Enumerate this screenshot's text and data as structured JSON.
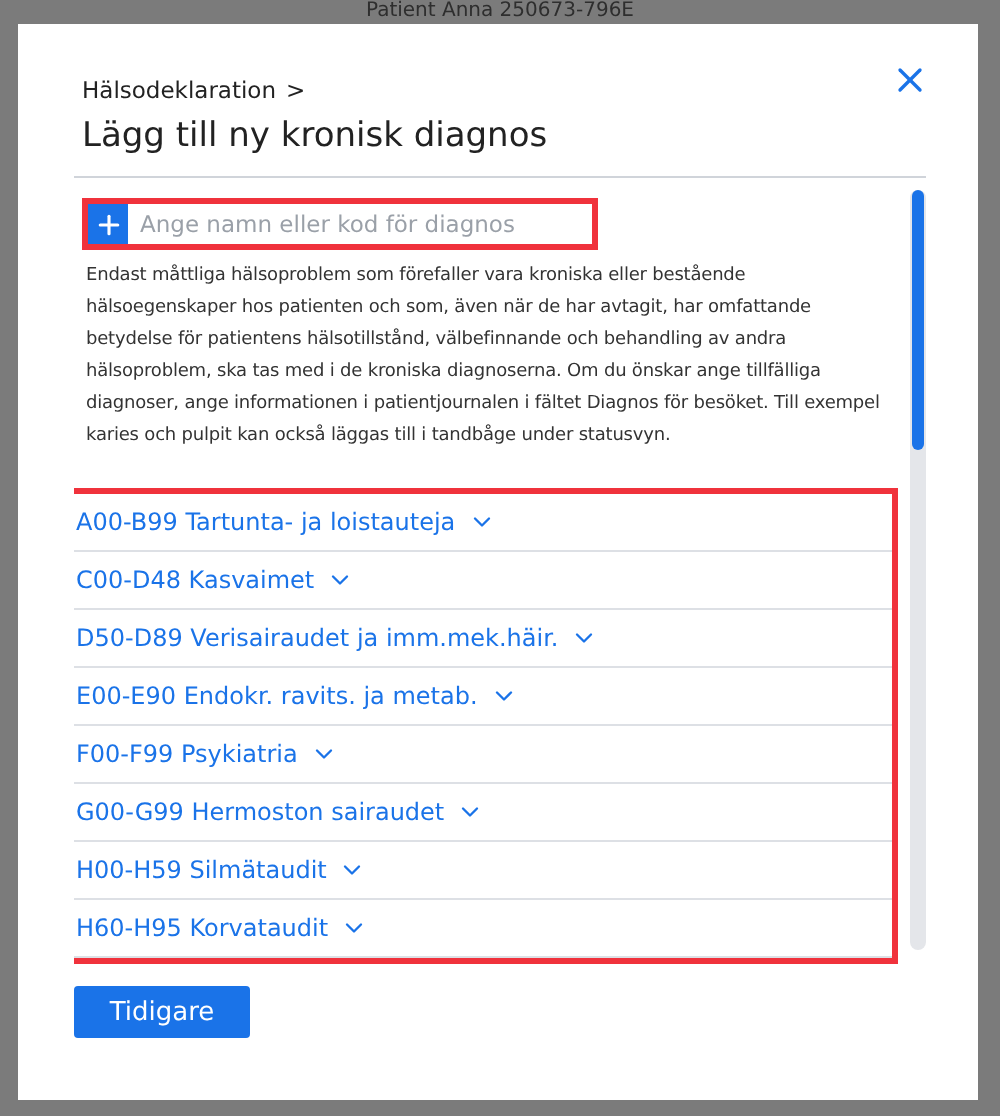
{
  "window": {
    "title": "Patient Anna 250673-796E"
  },
  "dialog": {
    "breadcrumb": "Hälsodeklaration",
    "breadcrumb_separator": ">",
    "title": "Lägg till ny kronisk diagnos",
    "search": {
      "placeholder": "Ange namn eller kod för diagnos"
    },
    "description": "Endast måttliga hälsoproblem som förefaller vara kroniska eller bestående hälsoegenskaper hos patienten och som, även när de har avtagit, har omfattande betydelse för patientens hälsotillstånd, välbefinnande och behandling av andra hälsoproblem, ska tas med i de kroniska diagnoserna. Om du önskar ange tillfälliga diagnoser, ange informationen i patientjournalen i fältet Diagnos för besöket. Till exempel karies och pulpit kan också läggas till i tandbåge under statusvyn.",
    "categories": [
      {
        "label": "A00-B99 Tartunta- ja loistauteja",
        "expanded": false
      },
      {
        "label": "C00-D48 Kasvaimet",
        "expanded": false
      },
      {
        "label": "D50-D89 Verisairaudet ja imm.mek.häir.",
        "expanded": false
      },
      {
        "label": "E00-E90 Endokr. ravits. ja metab.",
        "expanded": false
      },
      {
        "label": "F00-F99 Psykiatria",
        "expanded": false
      },
      {
        "label": "G00-G99 Hermoston sairaudet",
        "expanded": false
      },
      {
        "label": "H00-H59 Silmätaudit",
        "expanded": false
      },
      {
        "label": "H60-H95 Korvataudit",
        "expanded": false
      }
    ],
    "buttons": [
      "Tidigare"
    ]
  }
}
